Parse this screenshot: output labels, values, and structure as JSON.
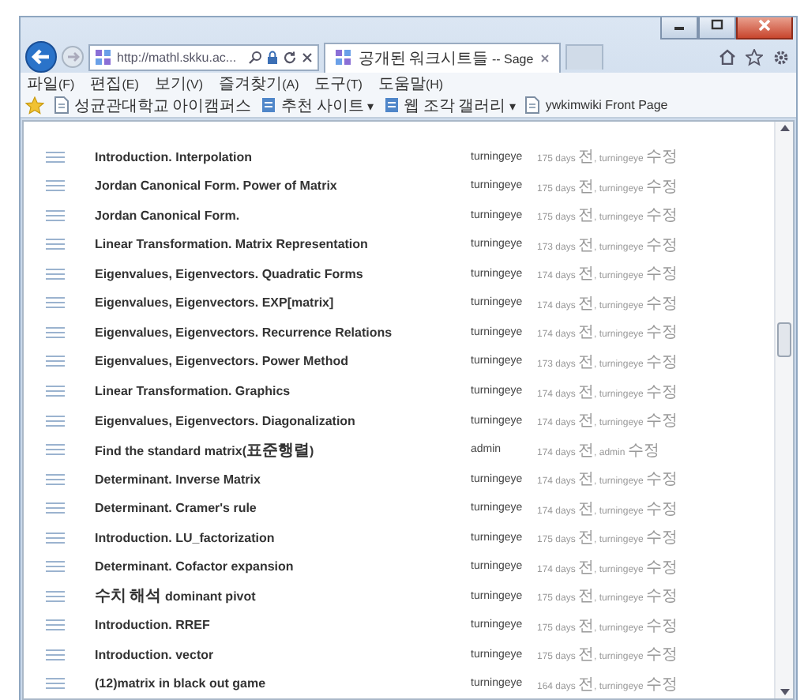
{
  "browser": {
    "address": "http://mathl.skku.ac...",
    "tabs": [
      {
        "label": "공개된 워크시트들 -- Sage",
        "selected": true
      }
    ],
    "menu": [
      "파일(F)",
      "편집(E)",
      "보기(V)",
      "즐겨찾기(A)",
      "도구(T)",
      "도움말(H)"
    ],
    "favorites": [
      {
        "label": "성균관대학교 아이캠퍼스",
        "kind": "link"
      },
      {
        "label": "추천 사이트 ▾",
        "kind": "dropdown"
      },
      {
        "label": "웹 조각 갤러리 ▾",
        "kind": "dropdown"
      },
      {
        "label": "ywkimwiki Front Page",
        "kind": "link"
      }
    ]
  },
  "worksheets": [
    {
      "title": "Introduction. Interpolation",
      "owner": "turningeye",
      "modified": "175 days 전, turningeye 수정"
    },
    {
      "title": "Jordan Canonical Form. Power of Matrix",
      "owner": "turningeye",
      "modified": "175 days 전, turningeye 수정"
    },
    {
      "title": "Jordan Canonical Form.",
      "owner": "turningeye",
      "modified": "175 days 전, turningeye 수정"
    },
    {
      "title": "Linear Transformation. Matrix Representation",
      "owner": "turningeye",
      "modified": "173 days 전, turningeye 수정"
    },
    {
      "title": "Eigenvalues, Eigenvectors. Quadratic Forms",
      "owner": "turningeye",
      "modified": "174 days 전, turningeye 수정"
    },
    {
      "title": "Eigenvalues, Eigenvectors. EXP[matrix]",
      "owner": "turningeye",
      "modified": "174 days 전, turningeye 수정"
    },
    {
      "title": "Eigenvalues, Eigenvectors. Recurrence Relations",
      "owner": "turningeye",
      "modified": "174 days 전, turningeye 수정"
    },
    {
      "title": "Eigenvalues, Eigenvectors. Power Method",
      "owner": "turningeye",
      "modified": "173 days 전, turningeye 수정"
    },
    {
      "title": "Linear Transformation. Graphics",
      "owner": "turningeye",
      "modified": "174 days 전, turningeye 수정"
    },
    {
      "title": "Eigenvalues, Eigenvectors. Diagonalization",
      "owner": "turningeye",
      "modified": "174 days 전, turningeye 수정"
    },
    {
      "title": "Find the standard matrix(표준행렬)",
      "owner": "admin",
      "modified": "174 days 전, admin 수정"
    },
    {
      "title": "Determinant. Inverse Matrix",
      "owner": "turningeye",
      "modified": "174 days 전, turningeye 수정"
    },
    {
      "title": "Determinant. Cramer's rule",
      "owner": "turningeye",
      "modified": "174 days 전, turningeye 수정"
    },
    {
      "title": "Introduction. LU_factorization",
      "owner": "turningeye",
      "modified": "175 days 전, turningeye 수정"
    },
    {
      "title": "Determinant. Cofactor expansion",
      "owner": "turningeye",
      "modified": "174 days 전, turningeye 수정"
    },
    {
      "title": "수치 해석 dominant pivot",
      "owner": "turningeye",
      "modified": "175 days 전, turningeye 수정"
    },
    {
      "title": "Introduction. RREF",
      "owner": "turningeye",
      "modified": "175 days 전, turningeye 수정"
    },
    {
      "title": "Introduction. vector",
      "owner": "turningeye",
      "modified": "175 days 전, turningeye 수정"
    },
    {
      "title": "(12)matrix in black out game",
      "owner": "turningeye",
      "modified": "164 days 전, turningeye 수정"
    }
  ]
}
